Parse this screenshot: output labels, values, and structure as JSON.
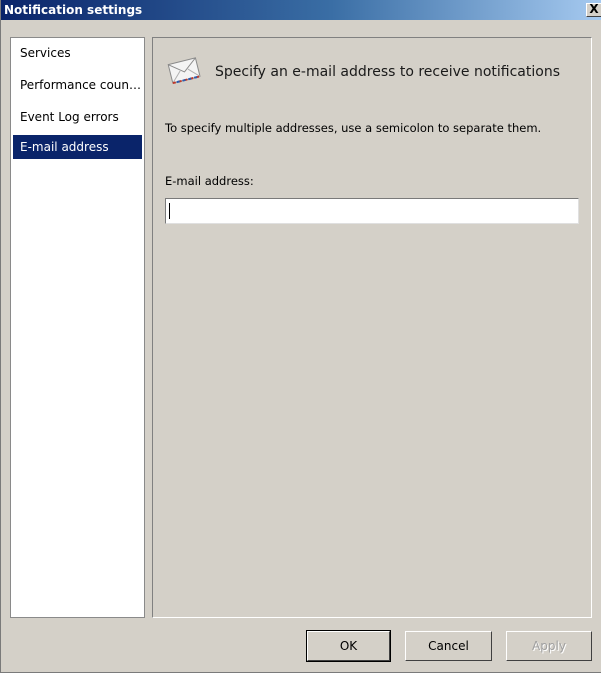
{
  "window": {
    "title": "Notification settings",
    "close_label": "X"
  },
  "nav": {
    "items": [
      {
        "label": "Services"
      },
      {
        "label": "Performance counters"
      },
      {
        "label": "Event Log errors"
      },
      {
        "label": "E-mail address"
      }
    ],
    "selected_index": 3
  },
  "content": {
    "icon": "envelope-icon",
    "heading": "Specify an e-mail address to receive notifications",
    "hint": "To specify multiple addresses, use a semicolon to separate them.",
    "field_label": "E-mail address:",
    "field_value": ""
  },
  "buttons": {
    "ok": "OK",
    "cancel": "Cancel",
    "apply": "Apply"
  },
  "colors": {
    "selection": "#0a246a",
    "face": "#d4d0c8"
  }
}
